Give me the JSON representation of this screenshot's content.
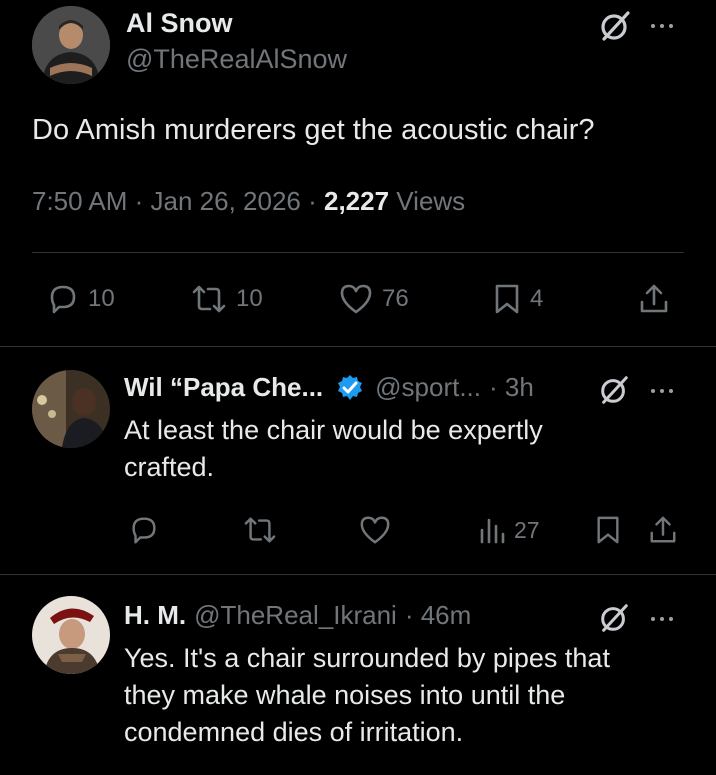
{
  "main_tweet": {
    "author_name": "Al Snow",
    "author_handle": "@TheRealAlSnow",
    "text": "Do Amish murderers get the acoustic chair?",
    "time": "7:50 AM",
    "date": "Jan 26, 2026",
    "views_count": "2,227",
    "views_label": "Views",
    "replies": "10",
    "reposts": "10",
    "likes": "76",
    "bookmarks": "4"
  },
  "replies": [
    {
      "author_name": "Wil “Papa Che...",
      "verified": true,
      "author_handle": "@sport...",
      "time": "· 3h",
      "text_line1": "At least the chair would be expertly",
      "text_line2": "crafted.",
      "views": "27"
    },
    {
      "author_name": "H. M.",
      "author_handle": "@TheReal_Ikrani",
      "time": "· 46m",
      "text_line1": "Yes. It's a chair surrounded by pipes that",
      "text_line2": "they make whale noises into until the",
      "text_line3": "condemned dies of irritation."
    }
  ],
  "colors": {
    "background": "#000000",
    "text": "#e7e9ea",
    "secondary": "#71767b",
    "verified": "#1d9bf0",
    "divider": "#2f3336"
  },
  "icons": [
    "reply-icon",
    "repost-icon",
    "like-icon",
    "bookmark-icon",
    "share-icon",
    "grok-icon",
    "more-icon",
    "views-icon",
    "verified-badge-icon"
  ]
}
